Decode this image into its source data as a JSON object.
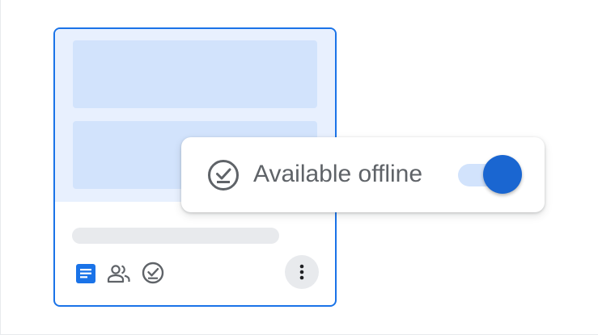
{
  "offline_popup": {
    "label": "Available offline",
    "toggle_on": true
  },
  "file_card": {
    "file_type_icon": "google-docs-icon",
    "shared_icon": "people-icon",
    "offline_icon": "offline-check-icon",
    "more_icon": "more-vert-icon"
  },
  "colors": {
    "accent": "#1a73e8",
    "toggle_thumb": "#1a66d1",
    "toggle_track": "#d2e3fc",
    "thumbnail_bg": "#e8f0fe",
    "placeholder_block": "#d2e3fc",
    "icon_gray": "#5f6368"
  }
}
